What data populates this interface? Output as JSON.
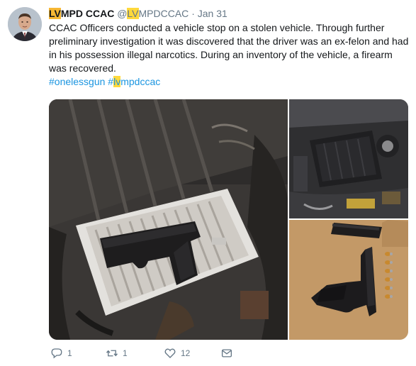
{
  "tweet": {
    "display_name_hl": "LV",
    "display_name_rest": "MPD CCAC",
    "handle_prefix": "@",
    "handle_hl": "LV",
    "handle_rest": "MPDCCAC",
    "separator": "·",
    "timestamp": "Jan 31",
    "body": "CCAC Officers conducted a vehicle stop on a stolen vehicle. Through further preliminary investigation it was discovered that the driver was an ex-felon and had in his possession illegal narcotics. During an inventory of the vehicle, a firearm was recovered.",
    "hashtag1": "#onelessgun",
    "hashtag2_prefix": "#",
    "hashtag2_hl": "lv",
    "hashtag2_rest": "mpdccac"
  },
  "actions": {
    "reply_count": "1",
    "retweet_count": "1",
    "like_count": "12"
  },
  "icons": {
    "reply": "reply-icon",
    "retweet": "retweet-icon",
    "like": "heart-icon",
    "message": "envelope-icon"
  },
  "colors": {
    "link": "#1b95e0",
    "highlight": "#ffd93b",
    "muted": "#657786"
  }
}
